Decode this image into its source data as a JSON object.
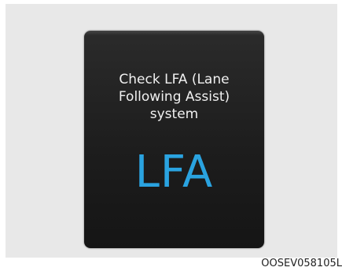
{
  "display": {
    "message": "Check LFA (Lane\nFollowing Assist)\nsystem",
    "indicator": "LFA"
  },
  "image_code": "OOSEV058105L",
  "colors": {
    "background_panel": "#e8e8e8",
    "display_bg": "#1d1d1d",
    "message_text": "#f0f0f0",
    "indicator_text": "#2aa3e0"
  }
}
